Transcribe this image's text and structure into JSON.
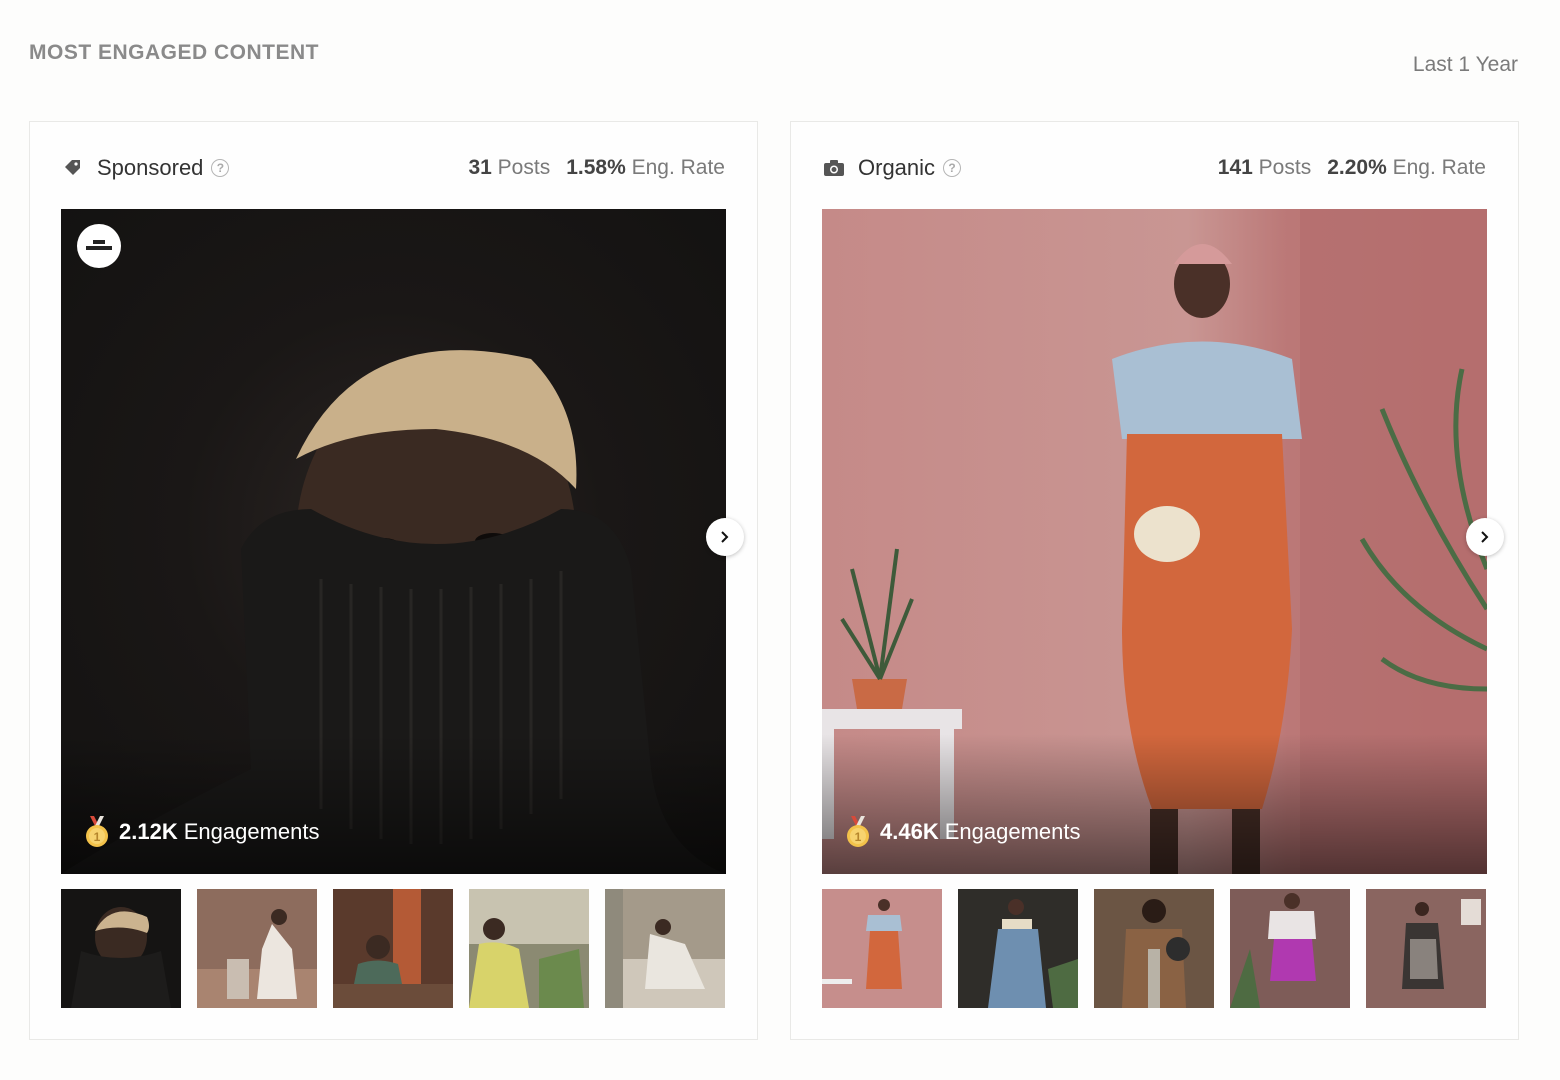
{
  "section": {
    "title": "MOST ENGAGED CONTENT",
    "range": "Last 1 Year"
  },
  "sponsored": {
    "label": "Sponsored",
    "help": "?",
    "icon": "price-tag-icon",
    "posts_count": "31",
    "posts_label": "Posts",
    "eng_rate": "1.58%",
    "eng_rate_label": "Eng. Rate",
    "engagements_value": "2.12K",
    "engagements_label": "Engagements",
    "brand_avatar": "brand-logo",
    "thumbnail_count": 5
  },
  "organic": {
    "label": "Organic",
    "help": "?",
    "icon": "camera-icon",
    "posts_count": "141",
    "posts_label": "Posts",
    "eng_rate": "2.20%",
    "eng_rate_label": "Eng. Rate",
    "engagements_value": "4.46K",
    "engagements_label": "Engagements",
    "thumbnail_count": 5
  },
  "icons": {
    "next": "chevron-right-icon",
    "medal": "gold-medal-icon",
    "help": "question-circle-icon"
  },
  "colors": {
    "heading": "#8a8a8a",
    "text": "#333333",
    "muted": "#7a7a7a",
    "border": "#e9e9e7"
  }
}
